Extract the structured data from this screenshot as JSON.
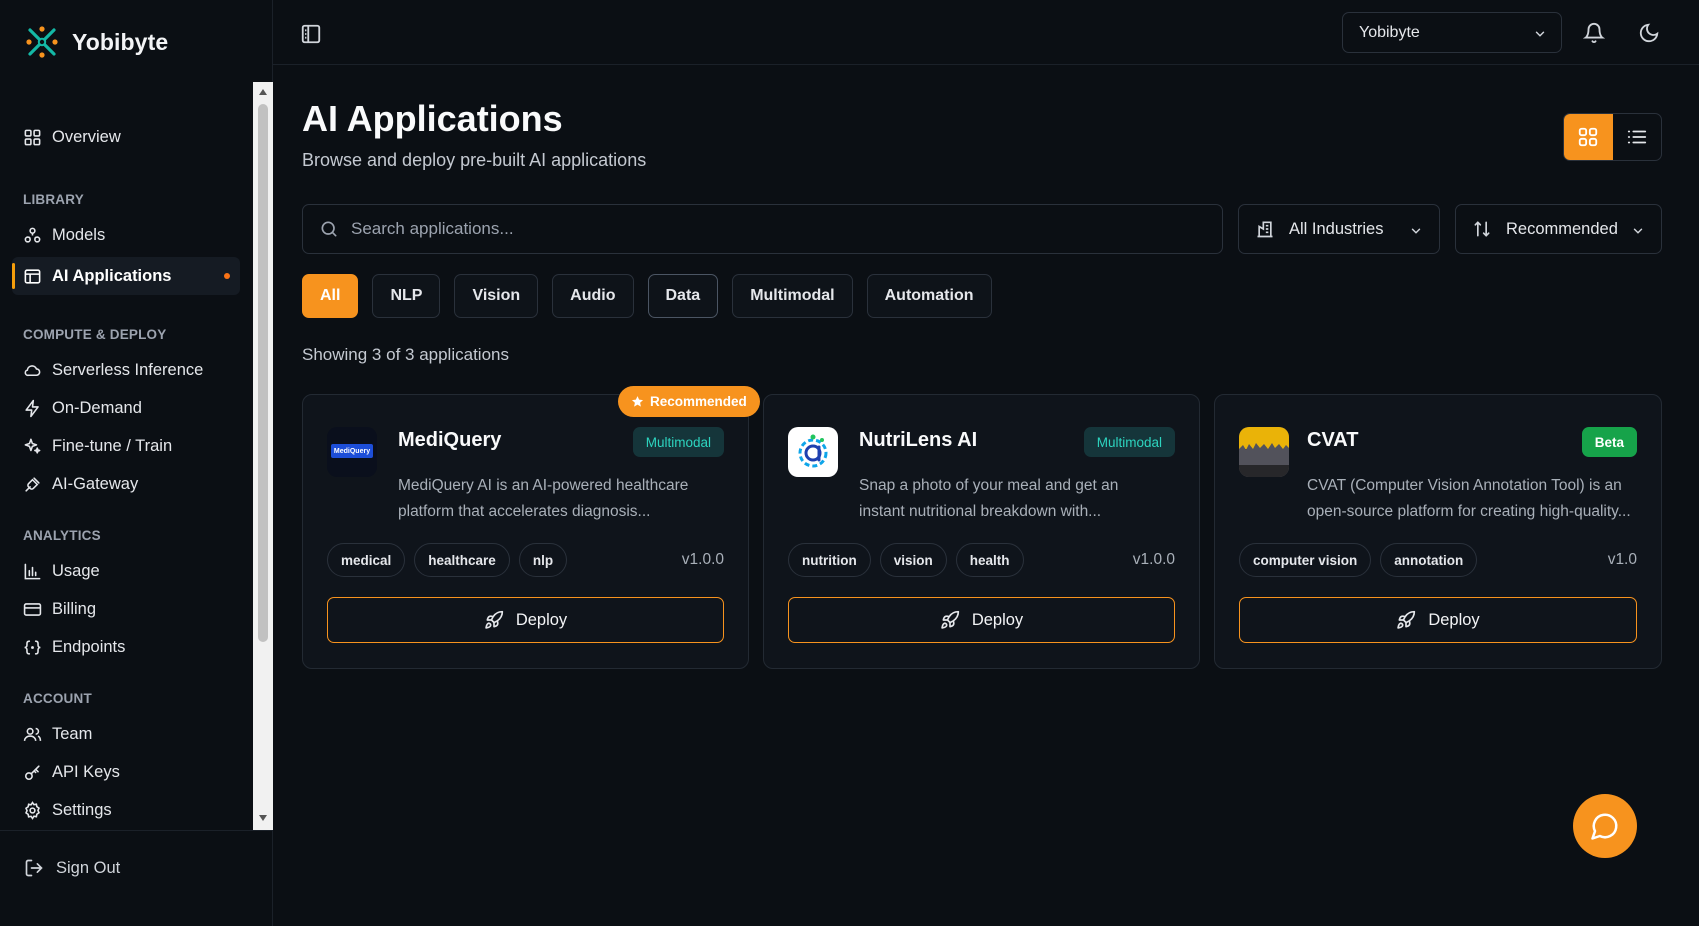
{
  "brand": {
    "name": "Yobibyte"
  },
  "sidebar": {
    "overview": "Overview",
    "sections": {
      "library": "LIBRARY",
      "compute": "COMPUTE & DEPLOY",
      "analytics": "ANALYTICS",
      "account": "ACCOUNT"
    },
    "items": {
      "models": "Models",
      "ai_applications": "AI Applications",
      "serverless": "Serverless Inference",
      "on_demand": "On-Demand",
      "finetune": "Fine-tune / Train",
      "gateway": "AI-Gateway",
      "usage": "Usage",
      "billing": "Billing",
      "endpoints": "Endpoints",
      "team": "Team",
      "api_keys": "API Keys",
      "settings": "Settings"
    },
    "active_item": "ai_applications",
    "sign_out": "Sign Out"
  },
  "topbar": {
    "org": "Yobibyte"
  },
  "page": {
    "title": "AI Applications",
    "subtitle": "Browse and deploy pre-built AI applications",
    "search_placeholder": "Search applications...",
    "industry_filter": "All Industries",
    "sort": "Recommended",
    "view_mode": "grid",
    "filters": [
      "All",
      "NLP",
      "Vision",
      "Audio",
      "Data",
      "Multimodal",
      "Automation"
    ],
    "active_filter": "All",
    "count_text": "Showing 3 of 3 applications"
  },
  "cards": [
    {
      "name": "MediQuery",
      "logo_text": "MediQuery",
      "badge": "Multimodal",
      "recommended_label": "Recommended",
      "desc_line1": "MediQuery AI is an AI-powered healthcare",
      "desc_line2": "platform that accelerates diagnosis...",
      "tags": [
        "medical",
        "healthcare",
        "nlp"
      ],
      "version": "v1.0.0",
      "deploy": "Deploy"
    },
    {
      "name": "NutriLens AI",
      "badge": "Multimodal",
      "desc_line1": "Snap a photo of your meal and get an",
      "desc_line2": "instant nutritional breakdown with...",
      "tags": [
        "nutrition",
        "vision",
        "health"
      ],
      "version": "v1.0.0",
      "deploy": "Deploy"
    },
    {
      "name": "CVAT",
      "badge": "Beta",
      "desc_line1": "CVAT (Computer Vision Annotation Tool) is an",
      "desc_line2": "open-source platform for creating high-quality...",
      "tags": [
        "computer vision",
        "annotation"
      ],
      "version": "v1.0",
      "deploy": "Deploy"
    }
  ],
  "colors": {
    "accent": "#f7931e",
    "background": "#0b0f14",
    "card": "#0f141b",
    "multimodal_badge": "#2dd4bf",
    "beta_badge": "#16a34a"
  }
}
